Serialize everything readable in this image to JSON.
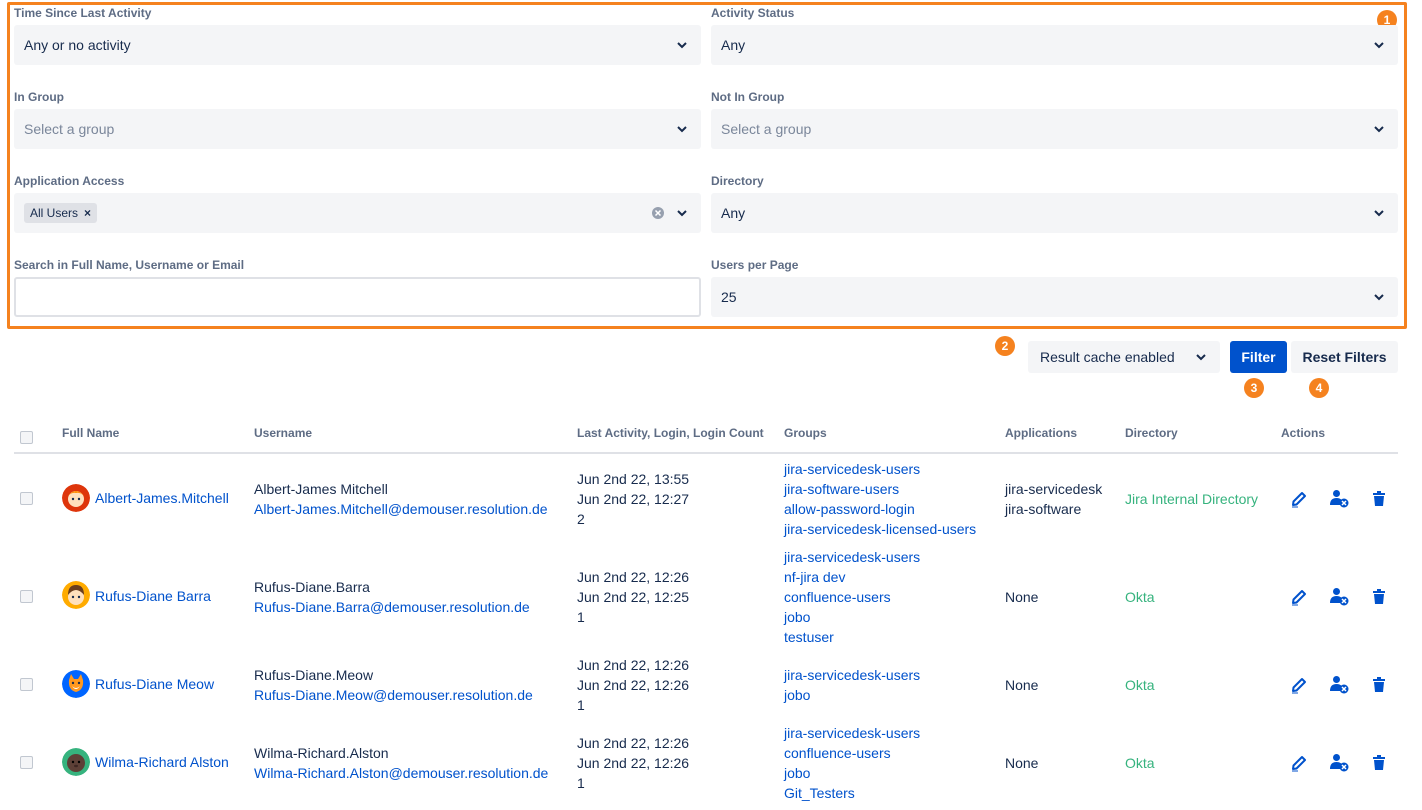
{
  "filters": {
    "time_since_label": "Time Since Last Activity",
    "time_since_value": "Any or no activity",
    "activity_status_label": "Activity Status",
    "activity_status_value": "Any",
    "in_group_label": "In Group",
    "in_group_placeholder": "Select a group",
    "not_in_group_label": "Not In Group",
    "not_in_group_placeholder": "Select a group",
    "app_access_label": "Application Access",
    "app_access_tag": "All Users",
    "directory_label": "Directory",
    "directory_value": "Any",
    "search_label": "Search in Full Name, Username or Email",
    "search_value": "",
    "users_per_page_label": "Users per Page",
    "users_per_page_value": "25"
  },
  "badges": [
    "1",
    "2",
    "3",
    "4"
  ],
  "toolbar": {
    "cache_label": "Result cache enabled",
    "filter_label": "Filter",
    "reset_label": "Reset Filters"
  },
  "table": {
    "headers": [
      "Full Name",
      "Username",
      "Last Activity, Login, Login Count",
      "Groups",
      "Applications",
      "Directory",
      "Actions"
    ],
    "rows": [
      {
        "full_name": "Albert-James.Mitchell",
        "username": "Albert-James Mitchell",
        "email": "Albert-James.Mitchell@demouser.resolution.de",
        "last_activity": "Jun 2nd 22, 13:55",
        "login": "Jun 2nd 22, 12:27",
        "count": "2",
        "groups": [
          "jira-servicedesk-users",
          "jira-software-users",
          "allow-password-login",
          "jira-servicedesk-licensed-users"
        ],
        "applications": [
          "jira-servicedesk",
          "jira-software"
        ],
        "directory": "Jira Internal Directory"
      },
      {
        "full_name": "Rufus-Diane Barra",
        "username": "Rufus-Diane.Barra",
        "email": "Rufus-Diane.Barra@demouser.resolution.de",
        "last_activity": "Jun 2nd 22, 12:26",
        "login": "Jun 2nd 22, 12:25",
        "count": "1",
        "groups": [
          "jira-servicedesk-users",
          "nf-jira dev",
          "confluence-users",
          "jobo",
          "testuser"
        ],
        "applications": [
          "None"
        ],
        "directory": "Okta"
      },
      {
        "full_name": "Rufus-Diane Meow",
        "username": "Rufus-Diane.Meow",
        "email": "Rufus-Diane.Meow@demouser.resolution.de",
        "last_activity": "Jun 2nd 22, 12:26",
        "login": "Jun 2nd 22, 12:26",
        "count": "1",
        "groups": [
          "jira-servicedesk-users",
          "jobo"
        ],
        "applications": [
          "None"
        ],
        "directory": "Okta"
      },
      {
        "full_name": "Wilma-Richard Alston",
        "username": "Wilma-Richard.Alston",
        "email": "Wilma-Richard.Alston@demouser.resolution.de",
        "last_activity": "Jun 2nd 22, 12:26",
        "login": "Jun 2nd 22, 12:26",
        "count": "1",
        "groups": [
          "jira-servicedesk-users",
          "confluence-users",
          "jobo",
          "Git_Testers"
        ],
        "applications": [
          "None"
        ],
        "directory": "Okta"
      }
    ]
  },
  "icons": {
    "chevron": "chevron-down-icon",
    "clear": "clear-icon",
    "edit": "pencil-icon",
    "deactivate": "user-remove-icon",
    "delete": "trash-icon"
  },
  "colors": {
    "accent": "#0052cc",
    "highlight": "#f5821f",
    "directory": "#36b37e"
  }
}
